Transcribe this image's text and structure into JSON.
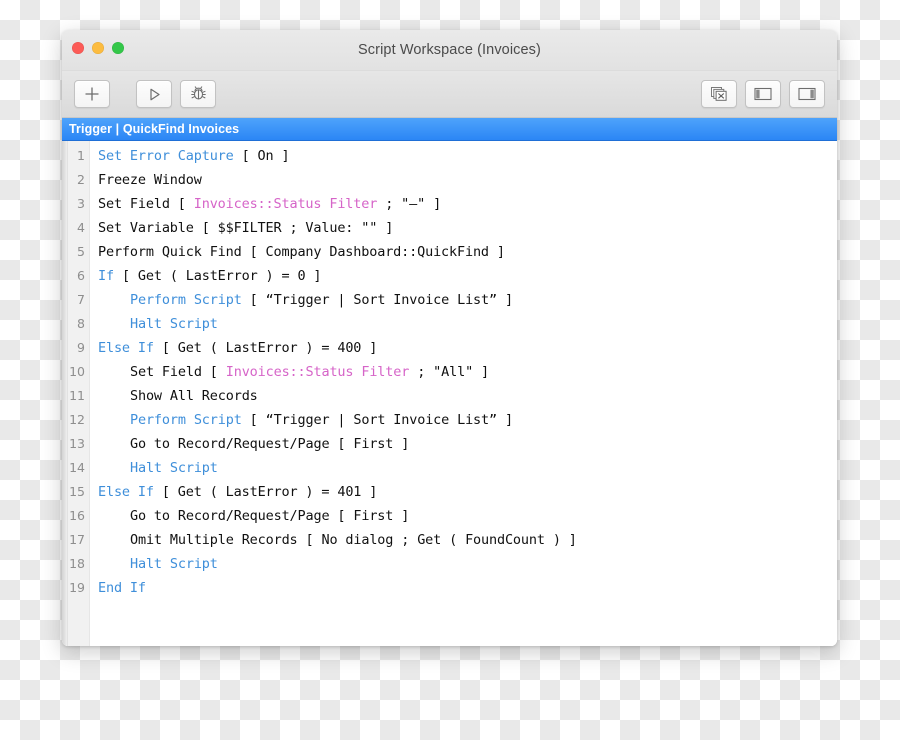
{
  "window": {
    "title": "Script Workspace (Invoices)",
    "traffic_lights": [
      {
        "name": "close",
        "color": "#fc5b57"
      },
      {
        "name": "minimize",
        "color": "#fcbc40"
      },
      {
        "name": "zoom",
        "color": "#34c749"
      }
    ]
  },
  "toolbar": {
    "buttons": [
      {
        "name": "new-script-button",
        "icon": "plus-icon",
        "tooltip": "New Script"
      },
      {
        "name": "run-script-button",
        "icon": "play-triangle-icon",
        "tooltip": "Run Script"
      },
      {
        "name": "debug-script-button",
        "icon": "bug-icon",
        "tooltip": "Debug Script"
      },
      {
        "name": "close-all-tabs-button",
        "icon": "stacked-windows-close-icon",
        "tooltip": "Close All"
      },
      {
        "name": "toggle-left-pane-button",
        "icon": "left-pane-icon",
        "tooltip": "Show Script List"
      },
      {
        "name": "toggle-right-pane-button",
        "icon": "right-pane-icon",
        "tooltip": "Show Steps Pane"
      }
    ]
  },
  "tabs": [
    {
      "label": "Trigger | QuickFind Invoices",
      "active": true
    }
  ],
  "editor": {
    "accent_color": "#2b86f5",
    "keyword_color": "#3f8fda",
    "field_color": "#d664c8",
    "text_color": "#111111",
    "gutter_color": "#f1f1f1",
    "lines": [
      {
        "n": "1",
        "indent": 0,
        "parts": [
          {
            "t": "Set Error Capture",
            "c": "kw"
          },
          {
            "t": " [ On ]",
            "c": ""
          }
        ]
      },
      {
        "n": "2",
        "indent": 0,
        "parts": [
          {
            "t": "Freeze Window",
            "c": ""
          }
        ]
      },
      {
        "n": "3",
        "indent": 0,
        "parts": [
          {
            "t": "Set Field [ ",
            "c": ""
          },
          {
            "t": "Invoices::Status Filter",
            "c": "fld"
          },
          {
            "t": " ; \"–\" ]",
            "c": ""
          }
        ]
      },
      {
        "n": "4",
        "indent": 0,
        "parts": [
          {
            "t": "Set Variable [ $$FILTER ; Value: \"\" ]",
            "c": ""
          }
        ]
      },
      {
        "n": "5",
        "indent": 0,
        "parts": [
          {
            "t": "Perform Quick Find [ Company Dashboard::QuickFind ]",
            "c": ""
          }
        ]
      },
      {
        "n": "6",
        "indent": 0,
        "parts": [
          {
            "t": "If",
            "c": "kw"
          },
          {
            "t": " [ Get ( LastError ) = 0 ]",
            "c": ""
          }
        ]
      },
      {
        "n": "7",
        "indent": 1,
        "parts": [
          {
            "t": "Perform Script",
            "c": "kw"
          },
          {
            "t": " [ “Trigger | Sort Invoice List” ]",
            "c": ""
          }
        ]
      },
      {
        "n": "8",
        "indent": 1,
        "parts": [
          {
            "t": "Halt Script",
            "c": "kw"
          }
        ]
      },
      {
        "n": "9",
        "indent": 0,
        "parts": [
          {
            "t": "Else If",
            "c": "kw"
          },
          {
            "t": " [ Get ( LastError ) = 400 ]",
            "c": ""
          }
        ]
      },
      {
        "n": "10",
        "indent": 1,
        "parts": [
          {
            "t": "Set Field [ ",
            "c": ""
          },
          {
            "t": "Invoices::Status Filter",
            "c": "fld"
          },
          {
            "t": " ; \"All\" ]",
            "c": ""
          }
        ]
      },
      {
        "n": "11",
        "indent": 1,
        "parts": [
          {
            "t": "Show All Records",
            "c": ""
          }
        ]
      },
      {
        "n": "12",
        "indent": 1,
        "parts": [
          {
            "t": "Perform Script",
            "c": "kw"
          },
          {
            "t": " [ “Trigger | Sort Invoice List” ]",
            "c": ""
          }
        ]
      },
      {
        "n": "13",
        "indent": 1,
        "parts": [
          {
            "t": "Go to Record/Request/Page [ First ]",
            "c": ""
          }
        ]
      },
      {
        "n": "14",
        "indent": 1,
        "parts": [
          {
            "t": "Halt Script",
            "c": "kw"
          }
        ]
      },
      {
        "n": "15",
        "indent": 0,
        "parts": [
          {
            "t": "Else If",
            "c": "kw"
          },
          {
            "t": " [ Get ( LastError ) = 401 ]",
            "c": ""
          }
        ]
      },
      {
        "n": "16",
        "indent": 1,
        "parts": [
          {
            "t": "Go to Record/Request/Page [ First ]",
            "c": ""
          }
        ]
      },
      {
        "n": "17",
        "indent": 1,
        "parts": [
          {
            "t": "Omit Multiple Records [ No dialog ; Get ( FoundCount ) ]",
            "c": ""
          }
        ]
      },
      {
        "n": "18",
        "indent": 1,
        "parts": [
          {
            "t": "Halt Script",
            "c": "kw"
          }
        ]
      },
      {
        "n": "19",
        "indent": 0,
        "parts": [
          {
            "t": "End If",
            "c": "kw"
          }
        ]
      }
    ]
  }
}
